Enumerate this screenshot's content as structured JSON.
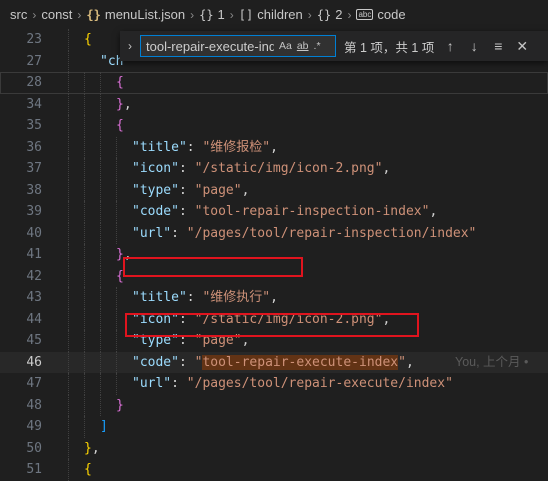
{
  "breadcrumb": {
    "items": [
      "src",
      "const",
      "menuList.json",
      "1",
      "children",
      "2",
      "code"
    ],
    "icons": [
      "",
      "",
      "json-braces-icon",
      "object-braces-icon",
      "array-brackets-icon",
      "object-braces-icon",
      "string-key-icon"
    ],
    "json_glyph": "{}",
    "obj_glyph": "{}",
    "arr_glyph": "[]",
    "code_glyph": "abc",
    "separator": "›"
  },
  "find_widget": {
    "toggle_glyph": "›",
    "query": "tool-repair-execute-index",
    "match_case": "Aa",
    "whole_word": "ab",
    "regex": ".*",
    "result_text": "第 1 项，共 1 项",
    "prev": "↑",
    "next": "↓",
    "selection": "≡",
    "close": "✕"
  },
  "blame": "You, 上个月 •",
  "lines": [
    {
      "no": "23",
      "tokens": [
        [
          "b3",
          "{"
        ]
      ]
    },
    {
      "no": "27",
      "tokens": [
        [
          "k",
          "\"ch"
        ]
      ]
    },
    {
      "no": "28",
      "tokens": [
        [
          "b1",
          "{"
        ]
      ]
    },
    {
      "no": "34",
      "tokens": [
        [
          "b1",
          "}"
        ],
        [
          "p",
          ","
        ]
      ]
    },
    {
      "no": "35",
      "tokens": [
        [
          "b1",
          "{"
        ]
      ]
    },
    {
      "no": "36",
      "tokens": [
        [
          "k",
          "\"title\""
        ],
        [
          "p",
          ": "
        ],
        [
          "s",
          "\"维修报检\""
        ],
        [
          "p",
          ","
        ]
      ]
    },
    {
      "no": "37",
      "tokens": [
        [
          "k",
          "\"icon\""
        ],
        [
          "p",
          ": "
        ],
        [
          "s",
          "\"/static/img/icon-2.png\""
        ],
        [
          "p",
          ","
        ]
      ]
    },
    {
      "no": "38",
      "tokens": [
        [
          "k",
          "\"type\""
        ],
        [
          "p",
          ": "
        ],
        [
          "s",
          "\"page\""
        ],
        [
          "p",
          ","
        ]
      ]
    },
    {
      "no": "39",
      "tokens": [
        [
          "k",
          "\"code\""
        ],
        [
          "p",
          ": "
        ],
        [
          "s",
          "\"tool-repair-inspection-index\""
        ],
        [
          "p",
          ","
        ]
      ]
    },
    {
      "no": "40",
      "tokens": [
        [
          "k",
          "\"url\""
        ],
        [
          "p",
          ": "
        ],
        [
          "s",
          "\"/pages/tool/repair-inspection/index\""
        ]
      ]
    },
    {
      "no": "41",
      "tokens": [
        [
          "b1",
          "}"
        ],
        [
          "p",
          ","
        ]
      ]
    },
    {
      "no": "42",
      "tokens": [
        [
          "b1",
          "{"
        ]
      ]
    },
    {
      "no": "43",
      "tokens": [
        [
          "k",
          "\"title\""
        ],
        [
          "p",
          ": "
        ],
        [
          "s",
          "\"维修执行\""
        ],
        [
          "p",
          ","
        ]
      ]
    },
    {
      "no": "44",
      "tokens": [
        [
          "k",
          "\"icon\""
        ],
        [
          "p",
          ": "
        ],
        [
          "s",
          "\"/static/img/icon-2.png\""
        ],
        [
          "p",
          ","
        ]
      ]
    },
    {
      "no": "45",
      "tokens": [
        [
          "k",
          "\"type\""
        ],
        [
          "p",
          ": "
        ],
        [
          "s",
          "\"page\""
        ],
        [
          "p",
          ","
        ]
      ]
    },
    {
      "no": "46",
      "tokens": [
        [
          "k",
          "\"code\""
        ],
        [
          "p",
          ": "
        ],
        [
          "s",
          "\""
        ],
        [
          "sm",
          "tool-repair-execute-index"
        ],
        [
          "s",
          "\""
        ],
        [
          "p",
          ","
        ]
      ]
    },
    {
      "no": "47",
      "tokens": [
        [
          "k",
          "\"url\""
        ],
        [
          "p",
          ": "
        ],
        [
          "s",
          "\"/pages/tool/repair-execute/index\""
        ]
      ]
    },
    {
      "no": "48",
      "tokens": [
        [
          "b1",
          "}"
        ]
      ]
    },
    {
      "no": "49",
      "tokens": [
        [
          "b2",
          "]"
        ]
      ]
    },
    {
      "no": "50",
      "tokens": [
        [
          "b3",
          "}"
        ],
        [
          "p",
          ","
        ]
      ]
    },
    {
      "no": "51",
      "tokens": [
        [
          "b3",
          "{"
        ]
      ]
    }
  ],
  "colors": {
    "background": "#1f1f1f",
    "key": "#9cdcfe",
    "string": "#ce9178",
    "bracket_gold": "#ffd700",
    "bracket_purple": "#da70d6",
    "bracket_blue": "#179fff",
    "find_match": "#623315",
    "annotation_red": "#e0141e"
  }
}
